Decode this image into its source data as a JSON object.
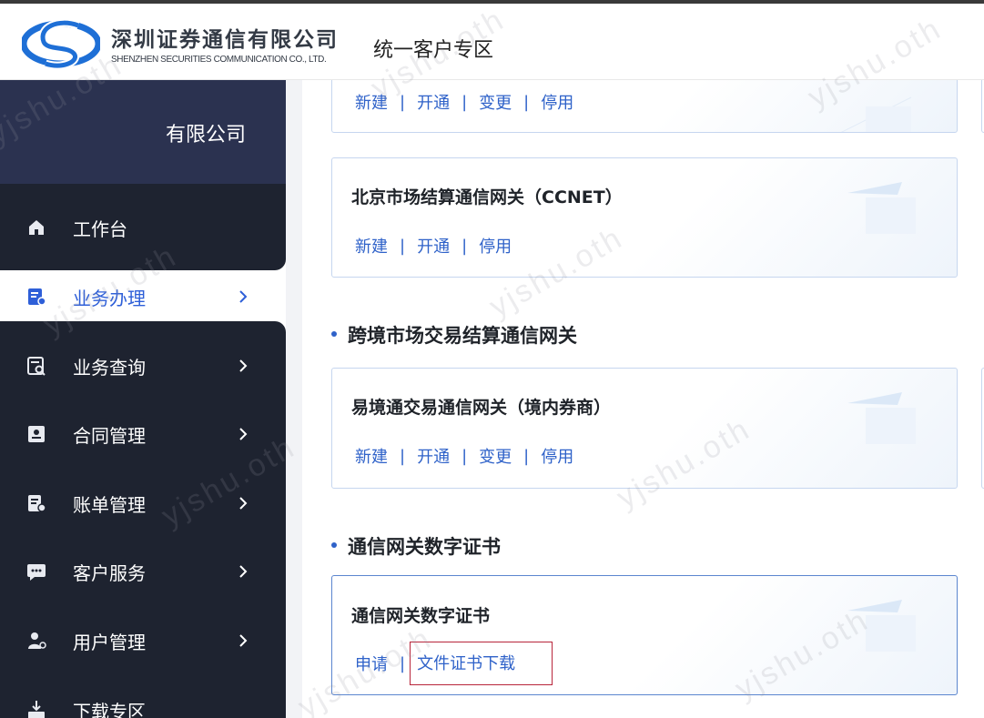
{
  "header": {
    "company_cn": "深圳证券通信有限公司",
    "company_en": "SHENZHEN SECURITIES COMMUNICATION CO., LTD.",
    "portal_title": "统一客户专区",
    "logo_color": "#1e6fd6"
  },
  "sidebar": {
    "company_name": "有限公司",
    "items": [
      {
        "label": "工作台",
        "icon": "home-icon"
      },
      {
        "label": "业务办理",
        "icon": "business-handling-icon",
        "active": true
      },
      {
        "label": "业务查询",
        "icon": "business-query-icon"
      },
      {
        "label": "合同管理",
        "icon": "contract-icon"
      },
      {
        "label": "账单管理",
        "icon": "bill-icon"
      },
      {
        "label": "客户服务",
        "icon": "customer-service-icon"
      },
      {
        "label": "用户管理",
        "icon": "user-management-icon"
      },
      {
        "label": "下载专区",
        "icon": "download-icon"
      }
    ]
  },
  "main": {
    "cards": [
      {
        "title": "",
        "actions": [
          "新建",
          "开通",
          "变更",
          "停用"
        ]
      },
      {
        "title": "北京市场结算通信网关（CCNET）",
        "actions": [
          "新建",
          "开通",
          "停用"
        ]
      },
      {
        "title": "易境通交易通信网关（境内券商）",
        "actions": [
          "新建",
          "开通",
          "变更",
          "停用"
        ]
      },
      {
        "title": "通信网关数字证书",
        "actions": [
          "申请",
          "文件证书下载"
        ]
      }
    ],
    "sections": [
      {
        "title": "跨境市场交易结算通信网关"
      },
      {
        "title": "通信网关数字证书"
      }
    ]
  },
  "watermark": "yjshu.oth",
  "colors": {
    "accent": "#2f62c9",
    "sidebar_dark": "#1e2330",
    "sidebar_header": "#2b3250",
    "highlight": "#b8253a"
  }
}
